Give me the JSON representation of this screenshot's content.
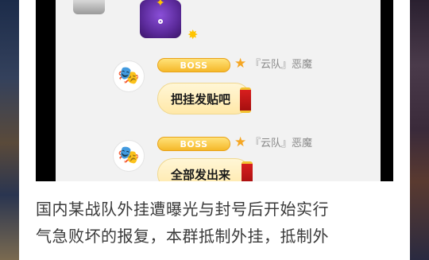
{
  "messages": [
    {
      "badge": "BOSS",
      "name": "『云队』恶魔",
      "text": "把挂发贴吧"
    },
    {
      "badge": "BOSS",
      "name": "『云队』恶魔",
      "text": "全部发出来"
    }
  ],
  "icons": {
    "avatar": "theater-mask-icon",
    "star": "star-icon",
    "lantern": "red-lantern-icon",
    "sticker": "purple-sticker-icon"
  },
  "colors": {
    "badge": "#f5b82a",
    "bubble": "#ffeeb8",
    "star": "#f5a623",
    "sticker": "#5b2a9a"
  },
  "article": {
    "line1": "国内某战队外挂遭曝光与封号后开始实行",
    "line2": "气急败坏的报复，本群抵制外挂，抵制外"
  }
}
